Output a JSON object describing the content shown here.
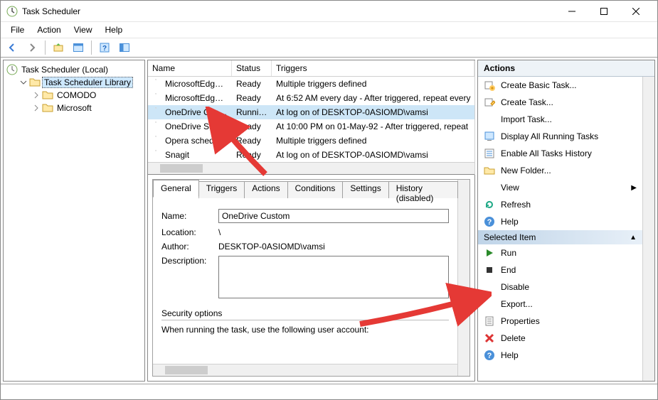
{
  "window": {
    "title": "Task Scheduler"
  },
  "menu": [
    "File",
    "Action",
    "View",
    "Help"
  ],
  "tree": {
    "root": "Task Scheduler (Local)",
    "library": "Task Scheduler Library",
    "children": [
      "COMODO",
      "Microsoft"
    ]
  },
  "grid": {
    "columns": [
      "Name",
      "Status",
      "Triggers"
    ],
    "rows": [
      {
        "name": "MicrosoftEdgeU…",
        "status": "Ready",
        "trigger": "Multiple triggers defined",
        "sel": false
      },
      {
        "name": "MicrosoftEdgeU…",
        "status": "Ready",
        "trigger": "At 6:52 AM every day - After triggered, repeat every",
        "sel": false
      },
      {
        "name": "OneDrive Custom",
        "status": "Running",
        "trigger": "At log on of DESKTOP-0ASIOMD\\vamsi",
        "sel": true
      },
      {
        "name": "OneDrive Sta…",
        "status": "Ready",
        "trigger": "At 10:00 PM on 01-May-92 - After triggered, repeat",
        "sel": false
      },
      {
        "name": "Opera schedule…",
        "status": "Ready",
        "trigger": "Multiple triggers defined",
        "sel": false
      },
      {
        "name": "Snagit",
        "status": "Ready",
        "trigger": "At log on of DESKTOP-0ASIOMD\\vamsi",
        "sel": false
      }
    ]
  },
  "tabs": [
    "General",
    "Triggers",
    "Actions",
    "Conditions",
    "Settings",
    "History (disabled)"
  ],
  "general": {
    "name_label": "Name:",
    "name_value": "OneDrive Custom",
    "location_label": "Location:",
    "location_value": "\\",
    "author_label": "Author:",
    "author_value": "DESKTOP-0ASIOMD\\vamsi",
    "description_label": "Description:",
    "security_label": "Security options",
    "security_text": "When running the task, use the following user account:"
  },
  "actions": {
    "header": "Actions",
    "group1": [
      {
        "icon": "task-new",
        "label": "Create Basic Task..."
      },
      {
        "icon": "task-create",
        "label": "Create Task..."
      },
      {
        "icon": "blank",
        "label": "Import Task..."
      },
      {
        "icon": "display",
        "label": "Display All Running Tasks"
      },
      {
        "icon": "history",
        "label": "Enable All Tasks History"
      },
      {
        "icon": "folder",
        "label": "New Folder..."
      },
      {
        "icon": "blank",
        "label": "View",
        "arrow": true
      },
      {
        "icon": "refresh",
        "label": "Refresh"
      },
      {
        "icon": "help",
        "label": "Help"
      }
    ],
    "group2_header": "Selected Item",
    "group2": [
      {
        "icon": "run",
        "label": "Run"
      },
      {
        "icon": "end",
        "label": "End"
      },
      {
        "icon": "blank",
        "label": "Disable"
      },
      {
        "icon": "blank",
        "label": "Export..."
      },
      {
        "icon": "props",
        "label": "Properties"
      },
      {
        "icon": "delete",
        "label": "Delete"
      },
      {
        "icon": "help",
        "label": "Help"
      }
    ]
  }
}
